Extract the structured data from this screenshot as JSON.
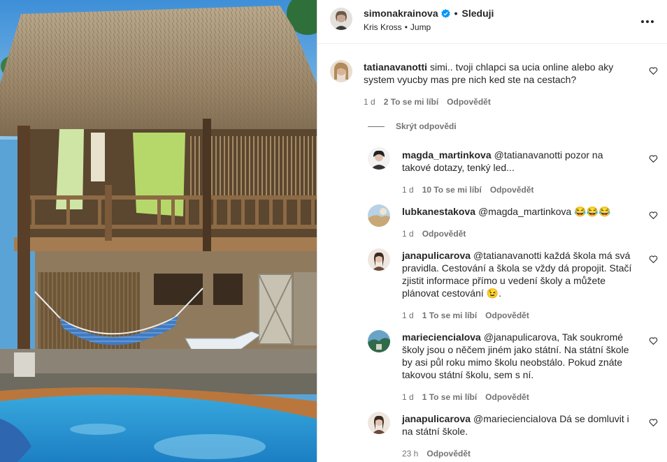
{
  "post": {
    "username": "simonakrainova",
    "follow_label": "Sleduji",
    "audio_artist": "Kris Kross",
    "audio_title": "Jump"
  },
  "comments": [
    {
      "username": "tatianavanotti",
      "text": "simi.. tvoji chlapci sa ucia online alebo aky system vyucby mas pre nich ked ste na cestach?",
      "time": "1 d",
      "likes": "2 To se mi líbí",
      "reply": "Odpovědět"
    }
  ],
  "hide_replies_label": "Skrýt odpovědi",
  "replies": [
    {
      "username": "magda_martinkova",
      "text": "@tatianavanotti pozor na takové dotazy, tenký led...",
      "time": "1 d",
      "likes": "10 To se mi líbí",
      "reply": "Odpovědět"
    },
    {
      "username": "lubkanestakova",
      "text": "@magda_martinkova 😂😂😂",
      "time": "1 d",
      "reply": "Odpovědět"
    },
    {
      "username": "janapulicarova",
      "text": "@tatianavanotti každá škola má svá pravidla. Cestování a škola se vždy dá propojit. Stačí zjistit informace přímo u vedení školy a můžete plánovat cestování 😉.",
      "time": "1 d",
      "likes": "1 To se mi líbí",
      "reply": "Odpovědět"
    },
    {
      "username": "mariecienciaIova",
      "text": "@janapulicarova, Tak soukromé školy jsou o něčem jiném jako státní. Na státní škole by asi půl roku mimo školu neobstálo. Pokud znáte takovou státní školu, sem s ní.",
      "time": "1 d",
      "likes": "1 To se mi líbí",
      "reply": "Odpovědět"
    },
    {
      "username": "janapulicarova",
      "text": "@mariecienciaIova Dá se domluvit i na státní škole.",
      "time": "23 h",
      "reply": "Odpovědět"
    }
  ],
  "icons": {
    "verified": "verified-badge-icon",
    "more": "more-options-icon",
    "heart": "heart-outline-icon"
  },
  "colors": {
    "accent": "#0095f6",
    "muted": "#737373",
    "text": "#262626"
  }
}
